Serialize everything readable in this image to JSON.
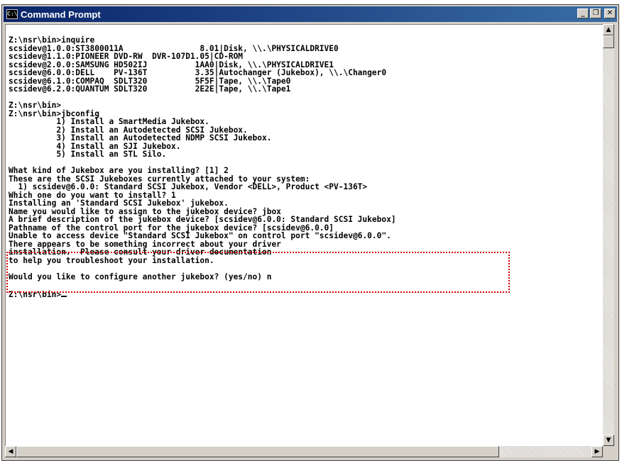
{
  "window": {
    "title": "Command Prompt",
    "icon_label": "C:\\",
    "minimize_glyph": "_",
    "maximize_glyph": "❐",
    "close_glyph": "✕"
  },
  "console": {
    "lines": [
      "Z:\\nsr\\bin>inquire",
      "scsidev@1.0.0:ST3800011A                8.01|Disk, \\\\.\\PHYSICALDRIVE0",
      "scsidev@1.1.0:PIONEER DVD-RW  DVR-107D1.05|CD-ROM",
      "scsidev@2.0.0:SAMSUNG HD502IJ          1AA0|Disk, \\\\.\\PHYSICALDRIVE1",
      "scsidev@6.0.0:DELL    PV-136T          3.35|Autochanger (Jukebox), \\\\.\\Changer0",
      "scsidev@6.1.0:COMPAQ  SDLT320          5F5F|Tape, \\\\.\\Tape0",
      "scsidev@6.2.0:QUANTUM SDLT320          2E2E|Tape, \\\\.\\Tape1",
      "",
      "Z:\\nsr\\bin>",
      "Z:\\nsr\\bin>jbconfig",
      "          1) Install a SmartMedia Jukebox.",
      "          2) Install an Autodetected SCSI Jukebox.",
      "          3) Install an Autodetected NDMP SCSI Jukebox.",
      "          4) Install an SJI Jukebox.",
      "          5) Install an STL Silo.",
      "",
      "What kind of Jukebox are you installing? [1] 2",
      "These are the SCSI Jukeboxes currently attached to your system:",
      "  1) scsidev@6.0.0: Standard SCSI Jukebox, Vendor <DELL>, Product <PV-136T>",
      "Which one do you want to install? 1",
      "Installing an 'Standard SCSI Jukebox' jukebox.",
      "Name you would like to assign to the jukebox device? jbox",
      "A brief description of the jukebox device? [scsidev@6.0.0: Standard SCSI Jukebox]",
      "Pathname of the control port for the jukebox device? [scsidev@6.0.0]",
      "Unable to access device \"Standard SCSI Jukebox\" on control port \"scsidev@6.0.0\".",
      "There appears to be something incorrect about your driver",
      "installation.  Please consult your driver documentation",
      "to help you troubleshoot your installation.",
      "",
      "Would you like to configure another jukebox? (yes/no) n",
      "",
      "Z:\\nsr\\bin>"
    ]
  },
  "scrollbar": {
    "up_glyph": "▲",
    "down_glyph": "▼",
    "left_glyph": "◀",
    "right_glyph": "▶"
  }
}
